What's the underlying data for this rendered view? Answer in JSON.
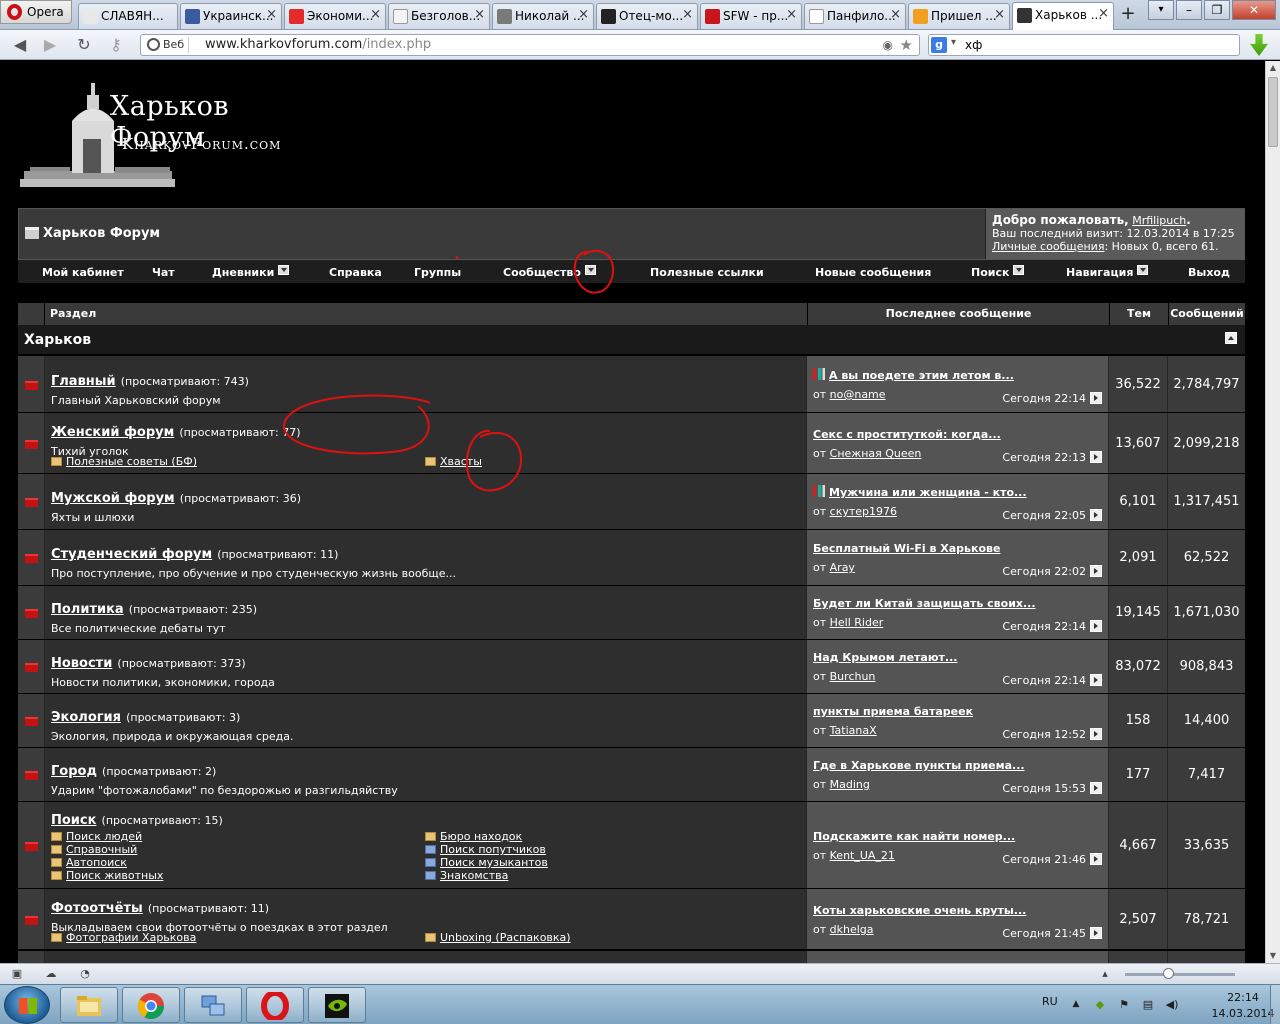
{
  "browser": {
    "menu_label": "Opera",
    "tabs": [
      {
        "title": "СЛАВЯН...",
        "favicon_color": "#e8e8e8"
      },
      {
        "title": "Украинск...",
        "favicon_color": "#3a5ba0"
      },
      {
        "title": "Экономи...",
        "favicon_color": "#e32b2b"
      },
      {
        "title": "Безголов...",
        "favicon_color": "#f4f4f4"
      },
      {
        "title": "Николай ...",
        "favicon_color": "#7a7a7a"
      },
      {
        "title": "Отец-мо...",
        "favicon_color": "#222222"
      },
      {
        "title": "SFW - пр...",
        "favicon_color": "#c8161d"
      },
      {
        "title": "Панфило...",
        "favicon_color": "#ffffff"
      },
      {
        "title": "Пришел ...",
        "favicon_color": "#f0a020"
      },
      {
        "title": "Харьков ...",
        "favicon_color": "#333333"
      }
    ],
    "badge": "Веб",
    "url_domain": "www.kharkovforum.com",
    "url_path": "/index.php",
    "search_engine": "g",
    "search_text": "хф",
    "window_buttons": [
      "–",
      "❐",
      "✕"
    ]
  },
  "forum": {
    "logo_title": "Харьков Форум",
    "logo_sub": "KharkovForum.com",
    "header_title": "Харьков Форум",
    "welcome": {
      "greeting": "Добро пожаловать,",
      "user": "Mrfilipuch",
      "after_user": ".",
      "last_visit": "Ваш последний визит: 12.03.2014 в 17:25",
      "pm_link": "Личные сообщения",
      "pm_counts": ": Новых 0, всего 61."
    },
    "menu": [
      "Мой кабинет",
      "Чат",
      "Дневники",
      "Справка",
      "Группы",
      "Сообщество",
      "Полезные ссылки",
      "Новые сообщения",
      "Поиск",
      "Навигация",
      "Выход"
    ],
    "columns": {
      "forum": "Раздел",
      "last": "Последнее сообщение",
      "threads": "Тем",
      "posts": "Сообщений"
    },
    "category": "Харьков",
    "rows": [
      {
        "title": "Главный",
        "views": "(просматривают: 743)",
        "desc": "Главный Харьковский форум",
        "subs": [],
        "last_title": "А вы поедете этим летом в...",
        "poll": true,
        "last_by": "от ",
        "last_user": "no@name",
        "last_time": "Сегодня 22:14",
        "threads": "36,522",
        "posts": "2,784,797"
      },
      {
        "title": "Женский форум",
        "views": "(просматривают: 77)",
        "desc": "Тихий уголок",
        "subs": [
          "Полезные советы (БФ)",
          "Хвасты"
        ],
        "last_title": "Секс с проституткой: когда...",
        "poll": false,
        "last_by": "от ",
        "last_user": "Снежная Queen",
        "last_time": "Сегодня 22:13",
        "threads": "13,607",
        "posts": "2,099,218"
      },
      {
        "title": "Мужской форум",
        "views": "(просматривают: 36)",
        "desc": "Яхты и шлюхи",
        "subs": [],
        "last_title": "Мужчина или женщина - кто...",
        "poll": true,
        "last_by": "от ",
        "last_user": "скутер1976",
        "last_time": "Сегодня 22:05",
        "threads": "6,101",
        "posts": "1,317,451"
      },
      {
        "title": "Студенческий форум",
        "views": "(просматривают: 11)",
        "desc": "Про поступление, про обучение и про студенческую жизнь вообще...",
        "subs": [],
        "last_title": "Бесплатный Wi-Fi в Харькове",
        "poll": false,
        "last_by": "от ",
        "last_user": "Aray",
        "last_time": "Сегодня 22:02",
        "threads": "2,091",
        "posts": "62,522"
      },
      {
        "title": "Политика",
        "views": "(просматривают: 235)",
        "desc": "Все политические дебаты тут",
        "subs": [],
        "last_title": "Будет ли Китай защищать своих...",
        "poll": false,
        "last_by": "от ",
        "last_user": "Hell Rider",
        "last_time": "Сегодня 22:14",
        "threads": "19,145",
        "posts": "1,671,030"
      },
      {
        "title": "Новости",
        "views": "(просматривают: 373)",
        "desc": "Новости политики, экономики, города",
        "subs": [],
        "last_title": "Над Крымом летают...",
        "poll": false,
        "last_by": "от ",
        "last_user": "Burchun",
        "last_time": "Сегодня 22:14",
        "threads": "83,072",
        "posts": "908,843"
      },
      {
        "title": "Экология",
        "views": "(просматривают: 3)",
        "desc": "Экология, природа и окружающая среда.",
        "subs": [],
        "last_title": "пункты приема батареек",
        "poll": false,
        "last_by": "от ",
        "last_user": "TatianaX",
        "last_time": "Сегодня 12:52",
        "threads": "158",
        "posts": "14,400"
      },
      {
        "title": "Город",
        "views": "(просматривают: 2)",
        "desc": "Ударим \"фотожалобами\" по бездорожью и разгильдяйству",
        "subs": [],
        "last_title": "Где в Харькове пункты приема...",
        "poll": false,
        "last_by": "от ",
        "last_user": "Mading",
        "last_time": "Сегодня 15:53",
        "threads": "177",
        "posts": "7,417"
      },
      {
        "title": "Поиск",
        "views": "(просматривают: 15)",
        "desc": "",
        "subs": [
          "Поиск людей",
          "Бюро находок",
          "Справочный",
          "Поиск попутчиков",
          "Автопоиск",
          "Поиск музыкантов",
          "Поиск животных",
          "Знакомства"
        ],
        "last_title": "Подскажите как найти номер...",
        "poll": false,
        "last_by": "от ",
        "last_user": "Kent_UA_21",
        "last_time": "Сегодня 21:46",
        "threads": "4,667",
        "posts": "33,635"
      },
      {
        "title": "Фотоотчёты",
        "views": "(просматривают: 11)",
        "desc": "Выкладываем свои фотоотчёты о поездках в этот раздел",
        "subs": [
          "Фотографии Харькова",
          "Unboxing (Распаковка)"
        ],
        "last_title": "Коты харьковские очень круты...",
        "poll": false,
        "last_by": "от ",
        "last_user": "dkhelga",
        "last_time": "Сегодня 21:45",
        "threads": "2,507",
        "posts": "78,721"
      }
    ]
  },
  "statusbar": {
    "zoom_label": "",
    "zoom_level": 0.38
  },
  "taskbar": {
    "apps": [
      "explorer-icon",
      "chrome-icon",
      "network-icon",
      "opera-icon",
      "nvidia-icon"
    ],
    "lang": "RU",
    "time": "22:14",
    "date": "14.03.2014"
  },
  "colors": {
    "page_bg": "#000000",
    "row_bg": "#2e2e2e",
    "last_bg": "#545454",
    "forum_icon": "#c41111",
    "annotation": "#e01010"
  }
}
